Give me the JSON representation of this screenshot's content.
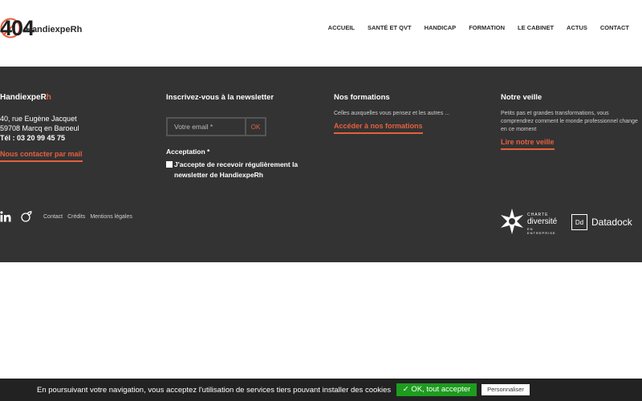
{
  "header": {
    "logo_404": "404",
    "logo_name_main": "HandiexpeRh",
    "logo_name_accent": "",
    "nav": [
      {
        "label": "ACCUEIL"
      },
      {
        "label": "SANTÉ ET QVT"
      },
      {
        "label": "HANDICAP"
      },
      {
        "label": "FORMATION"
      },
      {
        "label": "LE CABINET"
      },
      {
        "label": "ACTUS"
      },
      {
        "label": "CONTACT"
      }
    ]
  },
  "footer": {
    "col1": {
      "brand_main": "HandiexpeR",
      "brand_accent": "h",
      "address_line1": "40, rue Eugène Jacquet",
      "address_line2": "59708 Marcq en Baroeul",
      "tel": "Tél : 03 20 99 45 75",
      "contact_link": "Nous contacter par mail"
    },
    "col2": {
      "title": "Inscrivez-vous à la newsletter",
      "email_placeholder": "Votre email *",
      "ok_label": "OK",
      "acceptation_label": "Acceptation *",
      "accept_text": "J'accepte de recevoir régulièrement la newsletter de HandiexpeRh"
    },
    "col3": {
      "title": "Nos formations",
      "desc": "Celles auxquelles vous pensez et les autres ...",
      "link": "Accéder à nos formations"
    },
    "col4": {
      "title": "Notre veille",
      "desc": "Petits pas et grandes transformations, vous comprendrez comment le monde professionnel change en ce moment",
      "link": "Lire notre veille"
    },
    "legal_links": [
      {
        "label": "Contact"
      },
      {
        "label": "Crédits"
      },
      {
        "label": "Mentions légales"
      }
    ],
    "charte": {
      "line1": "CHARTE",
      "line2": "diversité",
      "line3": "EN ENTREPRISE"
    },
    "datadock": {
      "mark": "Dd",
      "name": "Datadock"
    }
  },
  "cookie_bar": {
    "text": "En poursuivant votre navigation, vous acceptez l'utilisation de services tiers pouvant installer des cookies",
    "accept_label": "✓ OK, tout accepter",
    "custom_label": "Personnaliser"
  },
  "colors": {
    "accent": "#e5603f",
    "footer_bg": "#333333",
    "cookie_bg": "#222222",
    "accept_green": "#1e9c1e"
  }
}
